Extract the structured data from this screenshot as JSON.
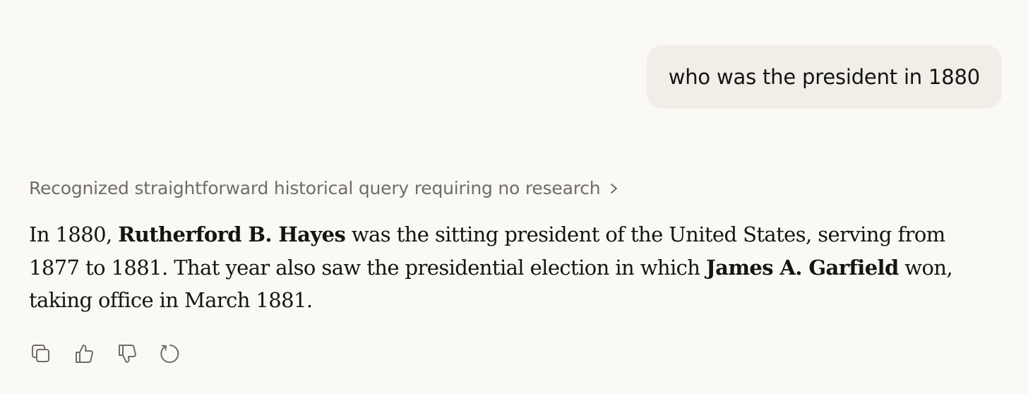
{
  "user_message": {
    "text": "who was the president in 1880"
  },
  "thinking": {
    "summary": "Recognized straightforward historical query requiring no research"
  },
  "response": {
    "seg1": "In 1880, ",
    "bold1": "Rutherford B. Hayes",
    "seg2": " was the sitting president of the United States, serving from 1877 to 1881. That year also saw the presidential election in which ",
    "bold2": "James A. Garfield",
    "seg3": " won, taking office in March 1881."
  },
  "actions": [
    {
      "icon": "copy-icon"
    },
    {
      "icon": "thumbs-up-icon"
    },
    {
      "icon": "thumbs-down-icon"
    },
    {
      "icon": "retry-icon"
    }
  ],
  "colors": {
    "background": "#faf9f5",
    "user_bubble": "#f0eee6",
    "text": "#141413",
    "muted_text": "#6f6d66"
  }
}
